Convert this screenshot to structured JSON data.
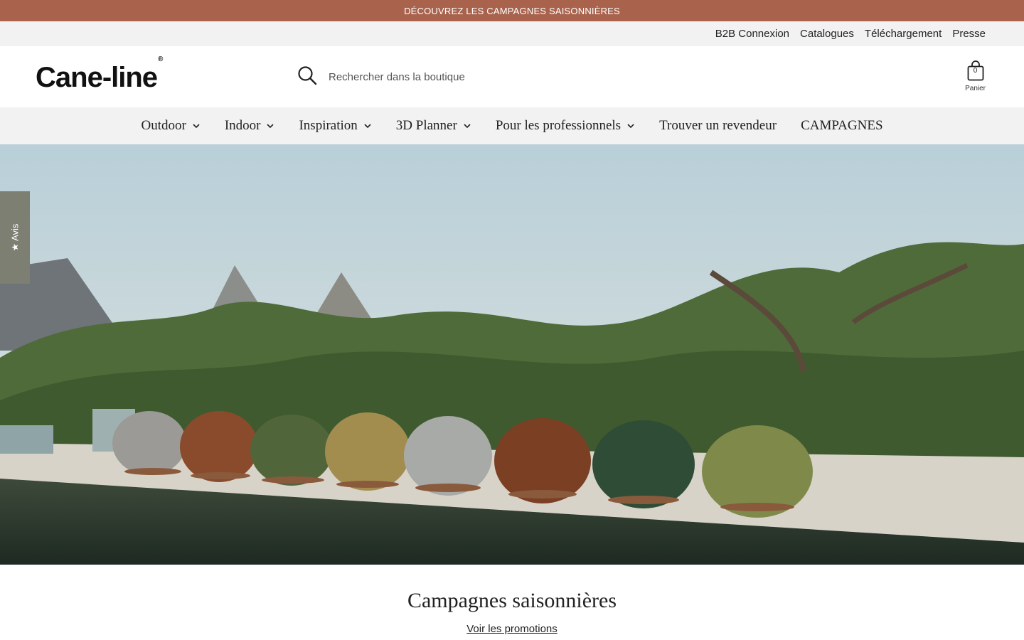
{
  "announcement": "DÉCOUVREZ LES CAMPAGNES SAISONNIÈRES",
  "utility_links": [
    "B2B Connexion",
    "Catalogues",
    "Téléchargement",
    "Presse"
  ],
  "logo": "Cane-line",
  "search": {
    "placeholder": "Rechercher dans la boutique",
    "icon": "search-icon"
  },
  "cart": {
    "count": "0",
    "label": "Panier",
    "icon": "bag-icon"
  },
  "nav": [
    {
      "label": "Outdoor",
      "dropdown": true
    },
    {
      "label": "Indoor",
      "dropdown": true
    },
    {
      "label": "Inspiration",
      "dropdown": true
    },
    {
      "label": "3D Planner",
      "dropdown": true
    },
    {
      "label": "Pour les professionnels",
      "dropdown": true
    },
    {
      "label": "Trouver un revendeur",
      "dropdown": false
    },
    {
      "label": "CAMPAGNES",
      "dropdown": false
    }
  ],
  "reviews_tab": "★ Avis",
  "section": {
    "title": "Campagnes saisonnières",
    "link": "Voir les promotions"
  },
  "colors": {
    "announce_bg": "#a9634d",
    "nav_bg": "#f2f2f2",
    "reviews_bg": "#7d7f73"
  }
}
